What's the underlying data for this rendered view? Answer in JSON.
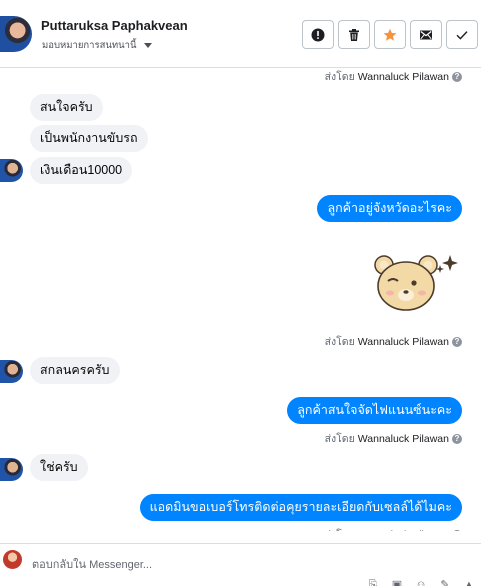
{
  "header": {
    "contact_name": "Puttaruksa Paphakvean",
    "assign_label": "มอบหมายการสนทนานี้"
  },
  "toolbar": {
    "icons": [
      "alert-icon",
      "trash-icon",
      "star-icon",
      "envelope-icon",
      "check-icon"
    ],
    "star_color": "#f7923b"
  },
  "thread": {
    "sent_prefix": "ส่งโดย",
    "agent_name": "Wannaluck Pilawan",
    "incoming": [
      "สนใจครับ",
      "เป็นพนักงานขับรถ",
      "เงินเดือน10000",
      "สกลนครครับ",
      "ใช่ครับ"
    ],
    "outgoing": [
      "ลูกค้าอยู่จังหวัดอะไรคะ",
      "ลูกค้าสนใจจัดไฟแนนซ์นะคะ",
      "แอดมินขอเบอร์โทรติดต่อคุยรายละเอียดกับเซลล์ได้ไมคะ"
    ],
    "accent_color": "#0084ff"
  },
  "composer": {
    "placeholder": "ตอบกลับใน Messenger..."
  }
}
